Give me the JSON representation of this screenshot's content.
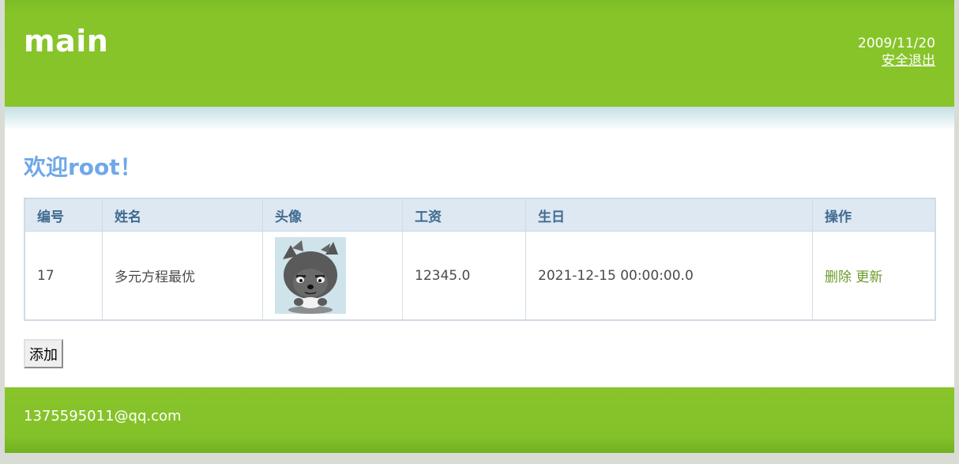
{
  "header": {
    "title": "main",
    "date": "2009/11/20",
    "logout_label": "安全退出"
  },
  "welcome_text": "欢迎root！",
  "table": {
    "columns": [
      "编号",
      "姓名",
      "头像",
      "工资",
      "生日",
      "操作"
    ],
    "rows": [
      {
        "id": "17",
        "name": "多元方程最优",
        "avatar_icon": "gray-wolf-cartoon-avatar",
        "salary": "12345.0",
        "birthday": "2021-12-15 00:00:00.0",
        "delete_label": "删除",
        "update_label": "更新"
      }
    ]
  },
  "add_button_label": "添加",
  "footer": {
    "email": "1375595011@qq.com"
  },
  "colors": {
    "header_green": "#88c42a",
    "welcome_blue": "#6fa8e8",
    "table_header_bg": "#dde8f2",
    "link_green": "#6c9a2c"
  }
}
